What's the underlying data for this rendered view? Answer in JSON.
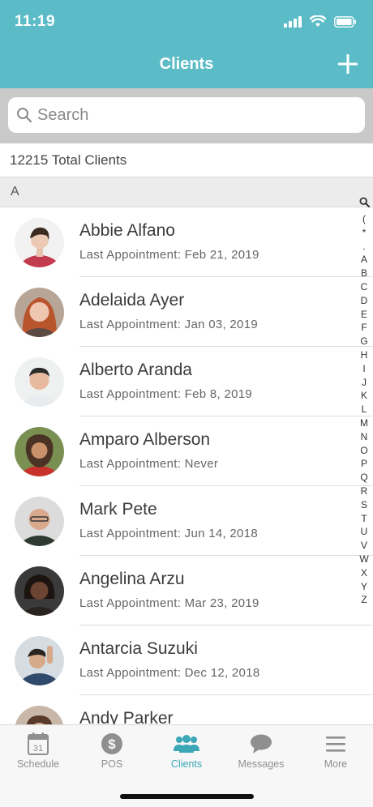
{
  "status": {
    "time": "11:19"
  },
  "nav": {
    "title": "Clients",
    "add_icon": "plus-icon"
  },
  "search": {
    "placeholder": "Search",
    "value": ""
  },
  "summary": {
    "total_text": "12215 Total Clients"
  },
  "section": {
    "letter": "A"
  },
  "clients": [
    {
      "name": "Abbie Alfano",
      "appointment": "Last Appointment: Feb 21, 2019"
    },
    {
      "name": "Adelaida Ayer",
      "appointment": "Last Appointment: Jan 03, 2019"
    },
    {
      "name": "Alberto Aranda",
      "appointment": "Last Appointment: Feb 8, 2019"
    },
    {
      "name": "Amparo Alberson",
      "appointment": "Last Appointment: Never"
    },
    {
      "name": "Mark Pete",
      "appointment": "Last Appointment: Jun 14, 2018"
    },
    {
      "name": "Angelina Arzu",
      "appointment": "Last Appointment: Mar 23, 2019"
    },
    {
      "name": "Antarcia Suzuki",
      "appointment": "Last Appointment: Dec 12, 2018"
    },
    {
      "name": "Andy Parker",
      "appointment": ""
    }
  ],
  "index_letters": [
    "(",
    "*",
    ".",
    "A",
    "B",
    "C",
    "D",
    "E",
    "F",
    "G",
    "H",
    "I",
    "J",
    "K",
    "L",
    "M",
    "N",
    "O",
    "P",
    "Q",
    "R",
    "S",
    "T",
    "U",
    "V",
    "W",
    "X",
    "Y",
    "Z"
  ],
  "tabs": [
    {
      "label": "Schedule",
      "icon": "calendar-icon",
      "active": false
    },
    {
      "label": "POS",
      "icon": "dollar-icon",
      "active": false
    },
    {
      "label": "Clients",
      "icon": "people-icon",
      "active": true
    },
    {
      "label": "Messages",
      "icon": "chat-bubble-icon",
      "active": false
    },
    {
      "label": "More",
      "icon": "menu-icon",
      "active": false
    }
  ],
  "calendar_day": "31",
  "colors": {
    "brand": "#5bbcc8",
    "active_tab": "#3ba7b7"
  }
}
